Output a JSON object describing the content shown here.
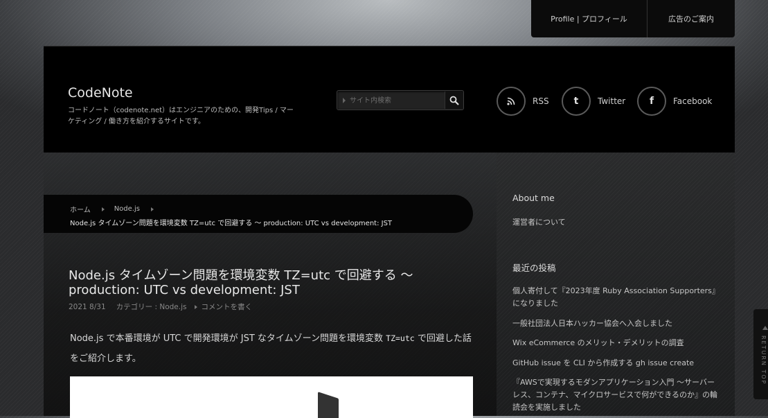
{
  "topnav": {
    "profile": "Profile | プロフィール",
    "ads": "広告のご案内"
  },
  "header": {
    "site_title": "CodeNote",
    "site_description": "コードノート（codenote.net）はエンジニアのための、開発Tips / マーケティング / 働き方を紹介するサイトです。",
    "search_placeholder": "サイト内検索",
    "social": {
      "rss": "RSS",
      "twitter": "Twitter",
      "facebook": "Facebook"
    }
  },
  "breadcrumb": {
    "home": "ホーム",
    "category": "Node.js",
    "current": "Node.js タイムゾーン問題を環境変数 TZ=utc で回避する 〜 production: UTC vs development: JST"
  },
  "post": {
    "title": "Node.js タイムゾーン問題を環境変数 TZ=utc で回避する 〜 production: UTC vs development: JST",
    "date": "2021 8/31",
    "category": "カテゴリー : Node.js",
    "comment": "コメントを書く",
    "lead_before": "Node.js で本番環境が UTC で開発環境が JST なタイムゾーン問題を環境変数 ",
    "lead_code": "TZ=utc",
    "lead_after": " で回避した話をご紹介します。"
  },
  "sidebar": {
    "about_heading": "About me",
    "about_link": "運営者について",
    "recent_heading": "最近の投稿",
    "recent_posts": [
      "個人寄付して『2023年度 Ruby Association Supporters』になりました",
      "一般社団法人日本ハッカー協会へ入会しました",
      "Wix eCommerce のメリット・デメリットの調査",
      "GitHub issue を CLI から作成する gh issue create",
      "『AWSで実現するモダンアプリケーション入門 〜サーバーレス、コンテナ、マイクロサービスで何ができるのか』の輪読会を実施しました"
    ]
  },
  "return_top": "RETURN TOP",
  "icons": {
    "search": "search-icon",
    "rss": "rss-icon",
    "twitter": "twitter-icon",
    "facebook": "facebook-icon"
  }
}
